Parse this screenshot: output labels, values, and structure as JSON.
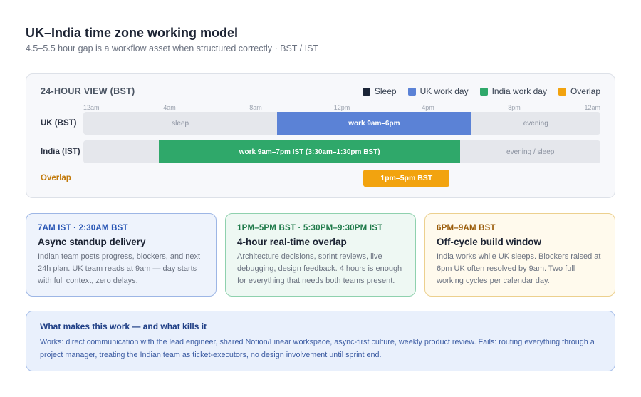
{
  "header": {
    "title": "UK–India time zone working model",
    "subtitle": "4.5–5.5 hour gap is a workflow asset when structured correctly · BST / IST"
  },
  "timeline": {
    "title": "24-HOUR VIEW (BST)",
    "legend": [
      {
        "label": "Sleep",
        "color": "#1b2537"
      },
      {
        "label": "UK work day",
        "color": "#5b82d6"
      },
      {
        "label": "India work day",
        "color": "#2fa86a"
      },
      {
        "label": "Overlap",
        "color": "#f2a30f"
      }
    ],
    "ticks": [
      {
        "label": "12am",
        "hour": 0
      },
      {
        "label": "4am",
        "hour": 4
      },
      {
        "label": "8am",
        "hour": 8
      },
      {
        "label": "12pm",
        "hour": 12
      },
      {
        "label": "4pm",
        "hour": 16
      },
      {
        "label": "8pm",
        "hour": 20
      },
      {
        "label": "12am",
        "hour": 24
      }
    ],
    "rows": [
      {
        "label": "UK (BST)",
        "segments": [
          {
            "start": 0,
            "end": 9,
            "label": "sleep",
            "kind": "rest"
          },
          {
            "start": 9,
            "end": 18,
            "label": "work 9am–6pm",
            "kind": "uk"
          },
          {
            "start": 18,
            "end": 24,
            "label": "evening",
            "kind": "rest"
          }
        ]
      },
      {
        "label": "India (IST)",
        "segments": [
          {
            "start": 0,
            "end": 3.5,
            "label": "",
            "kind": "rest"
          },
          {
            "start": 3.5,
            "end": 17.5,
            "label": "work 9am–7pm IST (3:30am–1:30pm BST)",
            "kind": "in"
          },
          {
            "start": 17.5,
            "end": 24,
            "label": "evening / sleep",
            "kind": "rest"
          }
        ]
      }
    ],
    "overlap": {
      "label": "Overlap",
      "start": 13,
      "end": 17,
      "bar_label": "1pm–5pm BST"
    }
  },
  "cards": [
    {
      "time": "7AM IST · 2:30AM BST",
      "title": "Async standup delivery",
      "body": "Indian team posts progress, blockers, and next 24h plan. UK team reads at 9am — day starts with full context, zero delays."
    },
    {
      "time": "1PM–5PM BST · 5:30PM–9:30PM IST",
      "title": "4-hour real-time overlap",
      "body": "Architecture decisions, sprint reviews, live debugging, design feedback. 4 hours is enough for everything that needs both teams present."
    },
    {
      "time": "6PM–9AM BST",
      "title": "Off-cycle build window",
      "body": "India works while UK sleeps. Blockers raised at 6pm UK often resolved by 9am. Two full working cycles per calendar day."
    }
  ],
  "summary": {
    "title": "What makes this work — and what kills it",
    "body": "Works: direct communication with the lead engineer, shared Notion/Linear workspace, async-first culture, weekly product review. Fails: routing everything through a project manager, treating the Indian team as ticket-executors, no design involvement until sprint end."
  }
}
